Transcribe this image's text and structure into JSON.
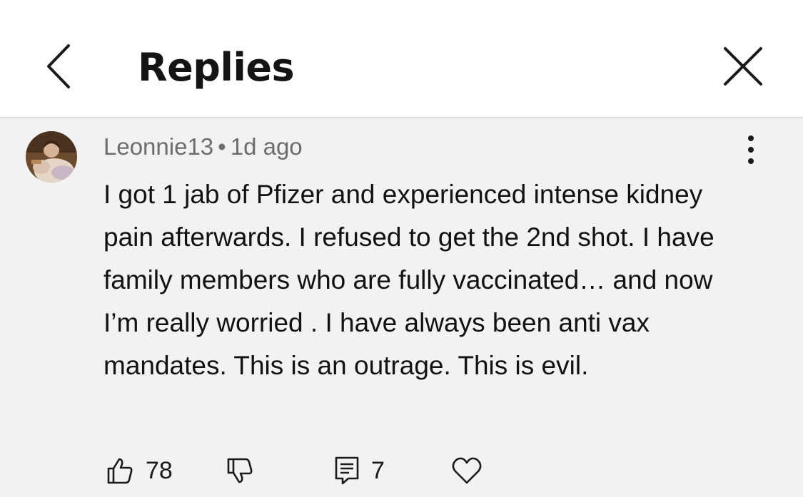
{
  "header": {
    "title": "Replies",
    "back_icon": "chevron-left-icon",
    "close_icon": "close-icon"
  },
  "comment": {
    "username": "Leonnie13",
    "separator": "•",
    "timestamp": "1d ago",
    "text": "I got 1 jab of Pfizer and experienced intense kidney pain afterwards. I refused to get the 2nd shot. I have family members who are fully vaccinated… and now I’m really worried . I have always been anti vax mandates. This is an outrage. This is evil.",
    "likes": "78",
    "replies": "7"
  },
  "icons": {
    "more": "more-vertical-icon",
    "like": "thumbs-up-icon",
    "dislike": "thumbs-down-icon",
    "reply": "comment-icon",
    "favorite": "heart-icon"
  },
  "colors": {
    "header_bg": "#ffffff",
    "content_bg": "#f2f2f2",
    "text": "#121212",
    "meta_text": "#6d6d6d"
  }
}
